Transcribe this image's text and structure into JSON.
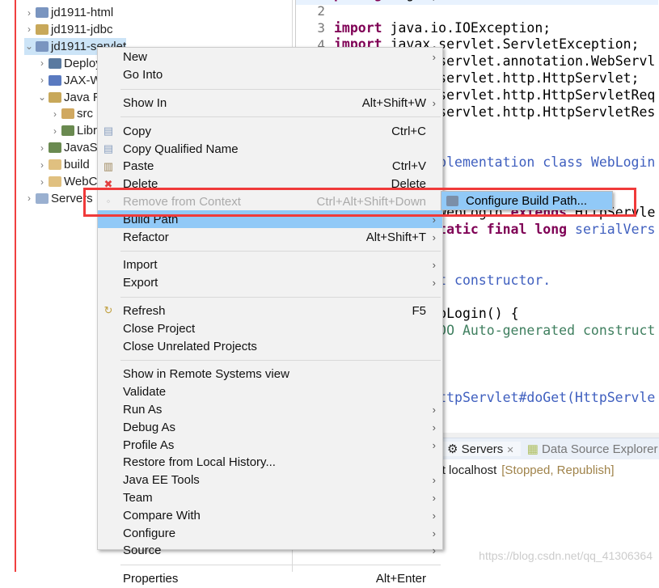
{
  "tree": [
    {
      "label": "jd1911-html",
      "level": 0,
      "expanded": false,
      "icon": "web-project-icon",
      "color": "#7a95c0"
    },
    {
      "label": "jd1911-jdbc",
      "level": 0,
      "expanded": false,
      "icon": "java-project-icon",
      "color": "#c8a85a"
    },
    {
      "label": "jd1911-servlet",
      "level": 0,
      "expanded": true,
      "icon": "web-project-icon",
      "color": "#7a95c0",
      "selected": true
    },
    {
      "label": "Deployment Descriptor",
      "level": 1,
      "expanded": false,
      "icon": "deployment-descriptor-icon",
      "color": "#5a7aa0"
    },
    {
      "label": "JAX-WS Web Services",
      "level": 1,
      "expanded": false,
      "icon": "web-service-icon",
      "color": "#5a7ac0"
    },
    {
      "label": "Java Resources",
      "level": 1,
      "expanded": true,
      "icon": "java-resources-icon",
      "color": "#c8a85a"
    },
    {
      "label": "src",
      "level": 2,
      "expanded": false,
      "icon": "source-folder-icon",
      "color": "#d0a860"
    },
    {
      "label": "Libraries",
      "level": 2,
      "expanded": false,
      "icon": "library-icon",
      "color": "#6a8a50"
    },
    {
      "label": "JavaScript Resources",
      "level": 1,
      "expanded": false,
      "icon": "library-icon",
      "color": "#6a8a50"
    },
    {
      "label": "build",
      "level": 1,
      "expanded": false,
      "icon": "folder-icon",
      "color": "#e0c080"
    },
    {
      "label": "WebContent",
      "level": 1,
      "expanded": false,
      "icon": "folder-icon",
      "color": "#e0c080"
    },
    {
      "label": "Servers",
      "level": 0,
      "expanded": false,
      "icon": "folder-icon",
      "color": "#9ab0d0"
    }
  ],
  "editor": {
    "line_numbers": [
      "2",
      "3",
      "4"
    ],
    "lines": [
      {
        "n": 1,
        "parts": [
          [
            "kw",
            "package"
          ],
          [
            "",
            "login;"
          ]
        ]
      },
      {
        "n": 2,
        "parts": []
      },
      {
        "n": 3,
        "parts": [
          [
            "kw",
            "import"
          ],
          [
            "",
            " java.io.IOException;"
          ]
        ]
      },
      {
        "n": 4,
        "parts": [
          [
            "kw",
            "import"
          ],
          [
            "",
            " javax.servlet.ServletException;"
          ]
        ]
      },
      {
        "n": 5,
        "parts": [
          [
            "kw",
            "import"
          ],
          [
            "",
            " javax.servlet.annotation.WebServlet;"
          ]
        ]
      },
      {
        "n": 6,
        "parts": [
          [
            "kw",
            "import"
          ],
          [
            "",
            " javax.servlet.http.HttpServlet;"
          ]
        ]
      },
      {
        "n": 7,
        "parts": [
          [
            "kw",
            "import"
          ],
          [
            "",
            " javax.servlet.http.HttpServletRequest;"
          ]
        ]
      },
      {
        "n": 8,
        "parts": [
          [
            "kw",
            "import"
          ],
          [
            "",
            " javax.servlet.http.HttpServletResponse;"
          ]
        ]
      },
      {
        "n": 11,
        "parts": [
          [
            "cm",
            " * Servlet implementation class WebLogin"
          ]
        ]
      },
      {
        "n": 14,
        "parts": [
          [
            "kw",
            "public class"
          ],
          [
            "",
            " WebLogin "
          ],
          [
            "kw",
            "extends"
          ],
          [
            "",
            " HttpServlet {"
          ]
        ]
      },
      {
        "n": 15,
        "parts": [
          [
            "",
            "    "
          ],
          [
            "kw",
            "private static final long"
          ],
          [
            "cm",
            " serialVersionUID"
          ]
        ]
      },
      {
        "n": 18,
        "parts": [
          [
            "cm",
            "     * Default constructor."
          ]
        ]
      },
      {
        "n": 20,
        "parts": [
          [
            "",
            "    "
          ],
          [
            "kw",
            "public"
          ],
          [
            "",
            " WebLogin() {"
          ]
        ]
      },
      {
        "n": 21,
        "parts": [
          [
            "tc",
            "        // TODO Auto-generated constructor stub"
          ]
        ]
      },
      {
        "n": 25,
        "parts": [
          [
            "cm",
            "     * @see HttpServlet#doGet(HttpServletRequest"
          ]
        ]
      }
    ]
  },
  "bottom": {
    "tabs": [
      {
        "label": "Servers",
        "icon": "servers-icon",
        "active": true,
        "close": "✕"
      },
      {
        "label": "Data Source Explorer",
        "icon": "data-source-icon",
        "active": false
      }
    ],
    "server_name": "Tomcat v9.0 Server at localhost",
    "server_status": "[Stopped, Republish]"
  },
  "context_menu": [
    {
      "label": "New",
      "submenu": true
    },
    {
      "label": "Go Into"
    },
    {
      "sep": true
    },
    {
      "label": "Show In",
      "shortcut": "Alt+Shift+W",
      "submenu": true
    },
    {
      "sep": true
    },
    {
      "label": "Copy",
      "shortcut": "Ctrl+C",
      "icon": "copy-icon"
    },
    {
      "label": "Copy Qualified Name",
      "icon": "copy-qualified-name-icon"
    },
    {
      "label": "Paste",
      "shortcut": "Ctrl+V",
      "icon": "paste-icon"
    },
    {
      "label": "Delete",
      "shortcut": "Delete",
      "icon": "delete-icon"
    },
    {
      "label": "Remove from Context",
      "shortcut": "Ctrl+Alt+Shift+Down",
      "disabled": true,
      "icon": "remove-context-icon"
    },
    {
      "label": "Build Path",
      "submenu": true,
      "highlighted": true
    },
    {
      "label": "Refactor",
      "shortcut": "Alt+Shift+T",
      "submenu": true
    },
    {
      "sep": true
    },
    {
      "label": "Import",
      "submenu": true
    },
    {
      "label": "Export",
      "submenu": true
    },
    {
      "sep": true
    },
    {
      "label": "Refresh",
      "shortcut": "F5",
      "icon": "refresh-icon"
    },
    {
      "label": "Close Project"
    },
    {
      "label": "Close Unrelated Projects"
    },
    {
      "sep": true
    },
    {
      "label": "Show in Remote Systems view"
    },
    {
      "label": "Validate"
    },
    {
      "label": "Run As",
      "submenu": true
    },
    {
      "label": "Debug As",
      "submenu": true
    },
    {
      "label": "Profile As",
      "submenu": true
    },
    {
      "label": "Restore from Local History..."
    },
    {
      "label": "Java EE Tools",
      "submenu": true
    },
    {
      "label": "Team",
      "submenu": true
    },
    {
      "label": "Compare With",
      "submenu": true
    },
    {
      "label": "Configure",
      "submenu": true
    },
    {
      "label": "Source",
      "submenu": true
    },
    {
      "sep": true
    },
    {
      "label": "Properties",
      "shortcut": "Alt+Enter"
    }
  ],
  "submenu": {
    "label": "Configure Build Path...",
    "icon": "configure-build-path-icon"
  },
  "highlight_color": "#91c9f7",
  "annotation_color": "#f03a3a",
  "watermark": "https://blog.csdn.net/qq_41306364"
}
